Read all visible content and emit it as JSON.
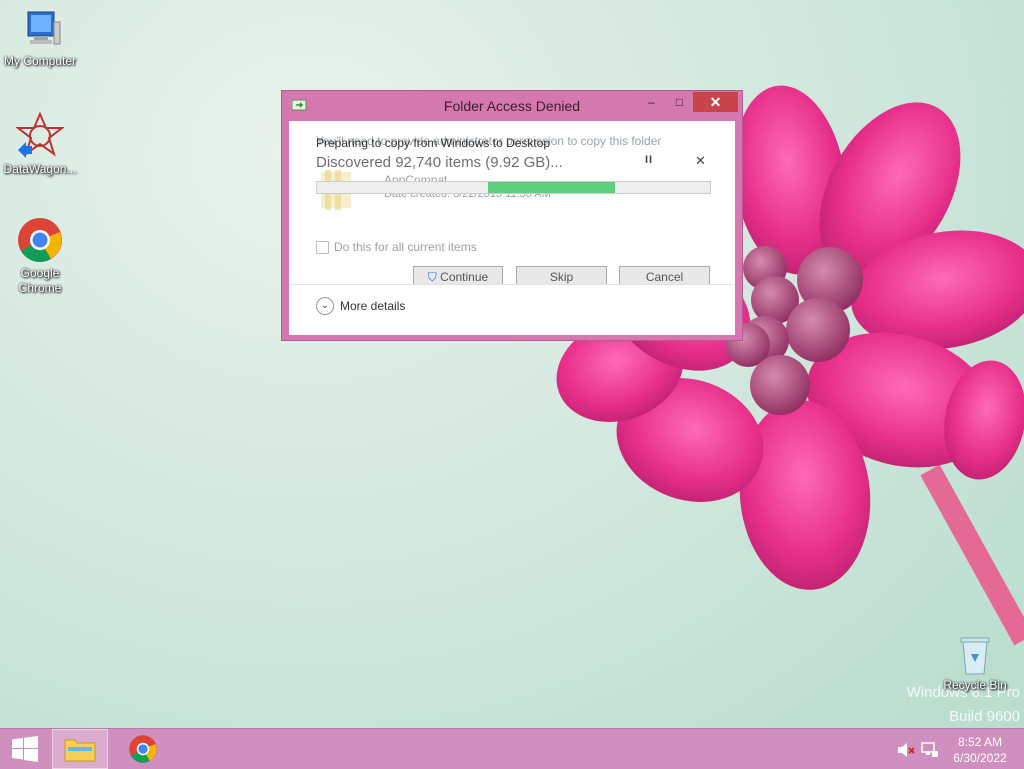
{
  "desktop": {
    "icons": [
      {
        "label": "My Computer",
        "icon": "computer-icon"
      },
      {
        "label": "DataWagon...",
        "icon": "datawagon-icon"
      },
      {
        "label": "Google Chrome",
        "icon": "chrome-icon"
      },
      {
        "label": "Recycle Bin",
        "icon": "recycle-bin-icon"
      }
    ],
    "watermark": {
      "line1": "Windows 8.1 Pro",
      "line2": "Build 9600"
    }
  },
  "dialog": {
    "title": "Folder Access Denied",
    "back_text": {
      "message": "You'll need to provide administrator permission to copy this folder",
      "file_name": "AppCompat",
      "date_created": "Date created: 8/22/2013 11:36 AM",
      "checkbox_label": "Do this for all current items",
      "continue_label": "Continue",
      "skip_label": "Skip",
      "cancel_label": "Cancel"
    },
    "copy_progress": {
      "status": "Preparing to copy from Windows to Desktop",
      "discovered": "Discovered 92,740 items (9.92 GB)...",
      "progress_fraction": 0.43,
      "more_details_label": "More details"
    },
    "controls": {
      "minimize": "–",
      "maximize": "□",
      "close": "✕",
      "pause": "II",
      "cancel_x": "✕"
    }
  },
  "taskbar": {
    "items": [
      {
        "name": "start-button",
        "icon": "windows-logo-icon"
      },
      {
        "name": "file-explorer",
        "icon": "folder-icon"
      },
      {
        "name": "chrome",
        "icon": "chrome-icon"
      }
    ],
    "clock": {
      "time": "8:52 AM",
      "date": "6/30/2022"
    }
  },
  "colors": {
    "accent": "#d678b0",
    "close_red": "#c7444a",
    "progress_green": "#5ecf7f",
    "taskbar": "#cf8fbf"
  }
}
